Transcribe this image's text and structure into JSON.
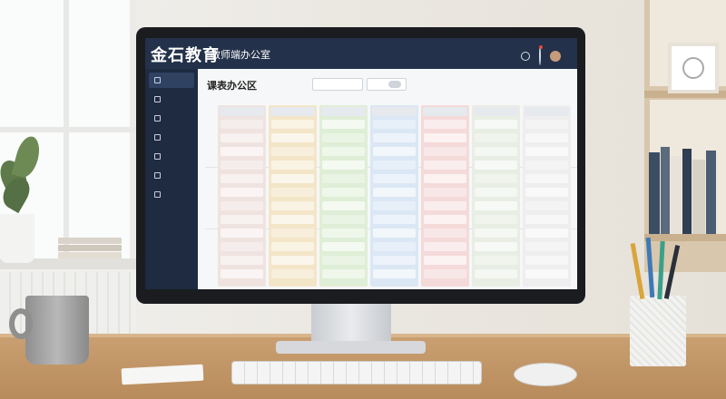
{
  "app": {
    "brand": "金石教育",
    "subtitle": "教师端办公室",
    "page_title": "课表办公区",
    "page_subtitle": "",
    "user_name": ""
  },
  "sidebar": {
    "items": [
      {
        "label": "",
        "active": true
      },
      {
        "label": "",
        "active": false
      },
      {
        "label": "",
        "active": false
      },
      {
        "label": "",
        "active": false
      },
      {
        "label": "",
        "active": false
      },
      {
        "label": "",
        "active": false
      },
      {
        "label": "",
        "active": false
      }
    ]
  },
  "toolbar": {
    "filter_select": "",
    "term_select": ""
  },
  "schedule": {
    "columns": [
      {
        "label": "",
        "color": "#efe3e0"
      },
      {
        "label": "",
        "color": "#f3e6c8"
      },
      {
        "label": "",
        "color": "#dfeed6"
      },
      {
        "label": "",
        "color": "#dbe7f4"
      },
      {
        "label": "",
        "color": "#f5dada"
      },
      {
        "label": "",
        "color": "#e9eee4"
      },
      {
        "label": "",
        "color": "#eeeeee"
      }
    ]
  },
  "colors": {
    "topbar": "#23314a",
    "sidebar": "#1e2b40",
    "accent_green": "#49a84a",
    "notification": "#e24a3a"
  }
}
